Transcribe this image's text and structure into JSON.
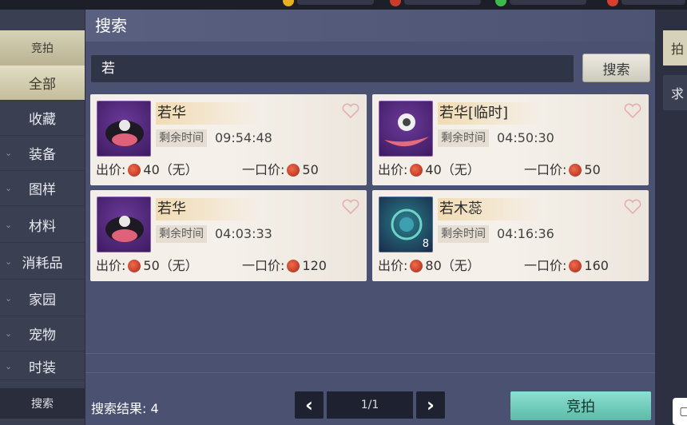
{
  "panel": {
    "title": "搜索"
  },
  "search": {
    "query": "若",
    "button_label": "搜索"
  },
  "sidebar": {
    "header": "竞拍",
    "items": [
      {
        "label": "全部",
        "active": true
      },
      {
        "label": "收藏",
        "active": false
      },
      {
        "label": "装备",
        "active": false
      },
      {
        "label": "图样",
        "active": false
      },
      {
        "label": "材料",
        "active": false
      },
      {
        "label": "消耗品",
        "active": false
      },
      {
        "label": "家园",
        "active": false
      },
      {
        "label": "宠物",
        "active": false
      },
      {
        "label": "时装",
        "active": false
      }
    ],
    "footer": "搜索"
  },
  "items": [
    {
      "name": "若华",
      "time_label": "剩余时间",
      "time": "09:54:48",
      "bid": "出价:",
      "bid_value": "40（无）",
      "buyout": "一口价:",
      "buyout_value": "50",
      "icon": "dark-hat-icon"
    },
    {
      "name": "若华[临时]",
      "time_label": "剩余时间",
      "time": "04:50:30",
      "bid": "出价:",
      "bid_value": "40（无）",
      "buyout": "一口价:",
      "buyout_value": "50",
      "icon": "feather-hat-icon"
    },
    {
      "name": "若华",
      "time_label": "剩余时间",
      "time": "04:03:33",
      "bid": "出价:",
      "bid_value": "50（无）",
      "buyout": "一口价:",
      "buyout_value": "120",
      "icon": "dark-hat-icon"
    },
    {
      "name": "若木蕊",
      "time_label": "剩余时间",
      "time": "04:16:36",
      "bid": "出价:",
      "bid_value": "80（无）",
      "buyout": "一口价:",
      "buyout_value": "160",
      "icon": "swirl-orb-icon",
      "qty": "8"
    }
  ],
  "footer": {
    "result_label": "搜索结果:",
    "result_count": "4",
    "page": "1/1",
    "auction_button": "竞拍"
  },
  "right_tabs": [
    "拍",
    "求"
  ],
  "colors": {
    "accent": "#6cc8b5",
    "panel": "#4b5170",
    "card": "#f3eee8",
    "coin": "#c9381f"
  }
}
